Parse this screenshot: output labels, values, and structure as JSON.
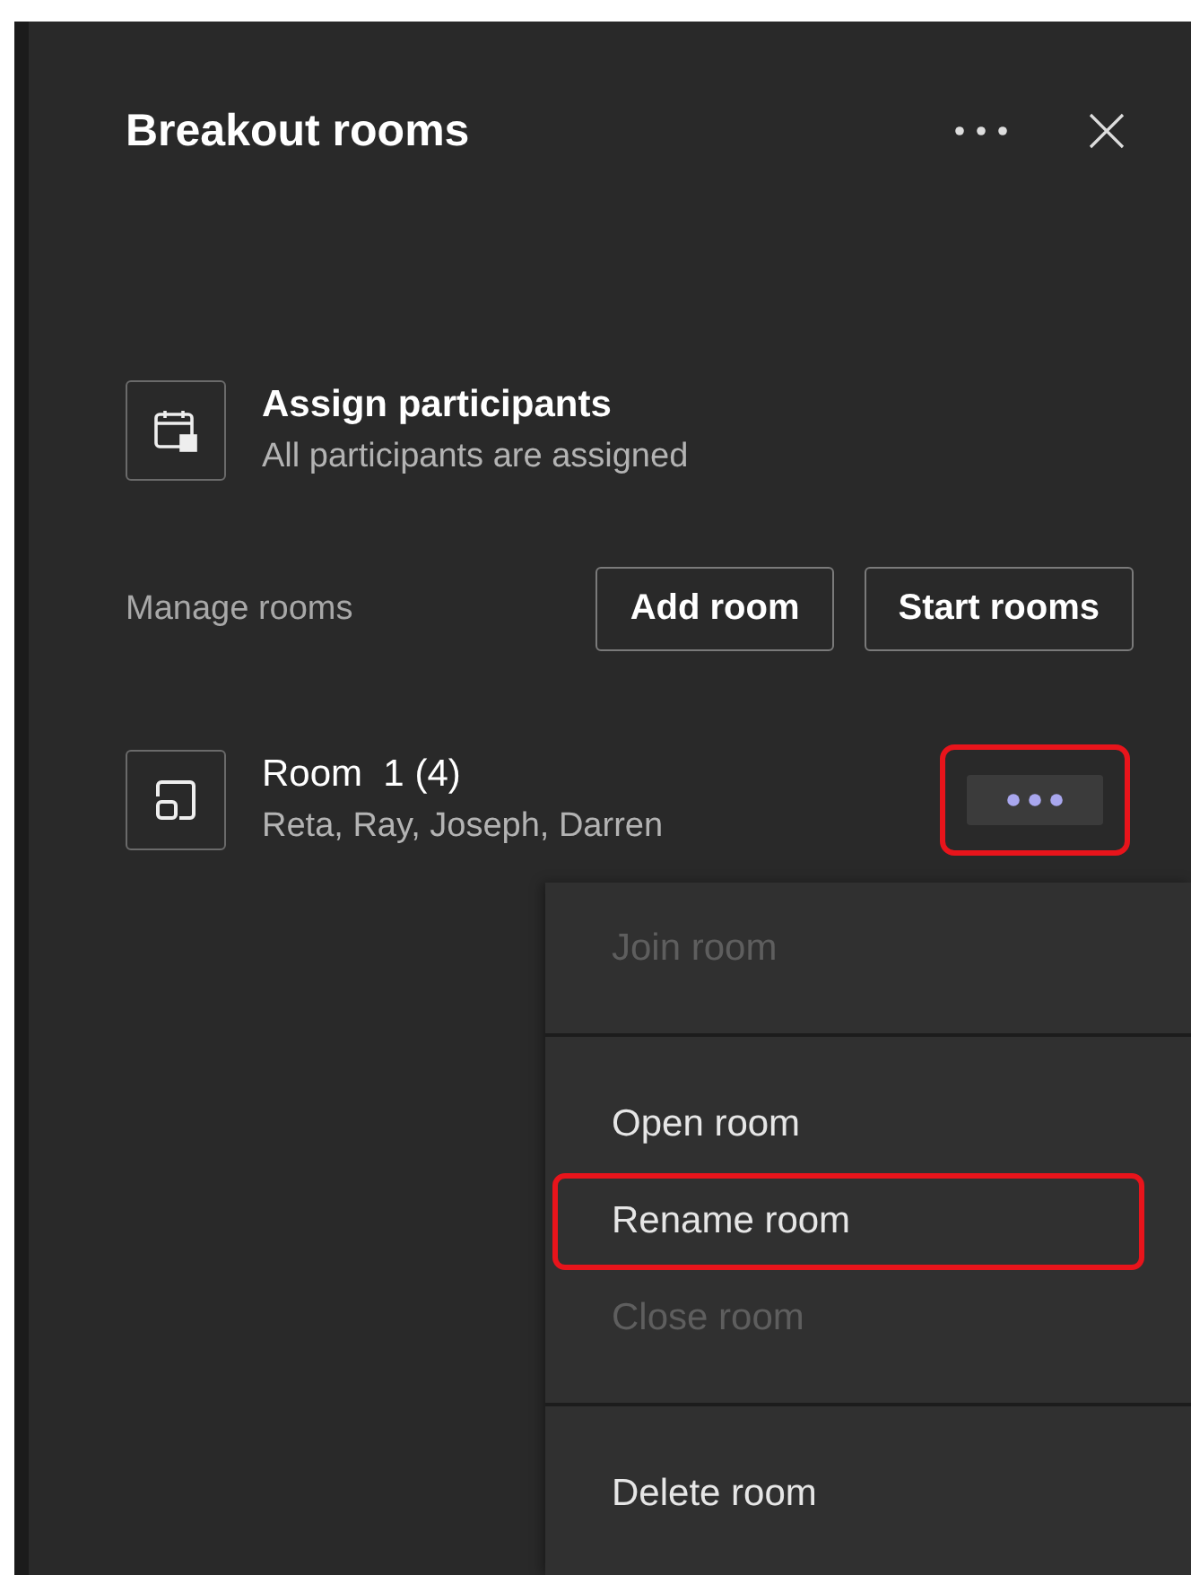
{
  "panel": {
    "title": "Breakout rooms"
  },
  "assign": {
    "title": "Assign participants",
    "subtitle": "All participants are assigned"
  },
  "manage": {
    "label": "Manage rooms",
    "buttons": [
      "Add room",
      "Start rooms"
    ]
  },
  "rooms": [
    {
      "name": "Room  1 (4)",
      "members": "Reta, Ray, Joseph, Darren",
      "more_highlighted": true
    }
  ],
  "menu": [
    {
      "kind": "item",
      "label": "Join room",
      "disabled": true,
      "highlighted": false
    },
    {
      "kind": "divider"
    },
    {
      "kind": "item",
      "label": "Open room",
      "disabled": false,
      "highlighted": false
    },
    {
      "kind": "item",
      "label": "Rename room",
      "disabled": false,
      "highlighted": true
    },
    {
      "kind": "item",
      "label": "Close room",
      "disabled": true,
      "highlighted": false
    },
    {
      "kind": "divider"
    },
    {
      "kind": "item",
      "label": "Delete room",
      "disabled": false,
      "highlighted": false
    }
  ]
}
